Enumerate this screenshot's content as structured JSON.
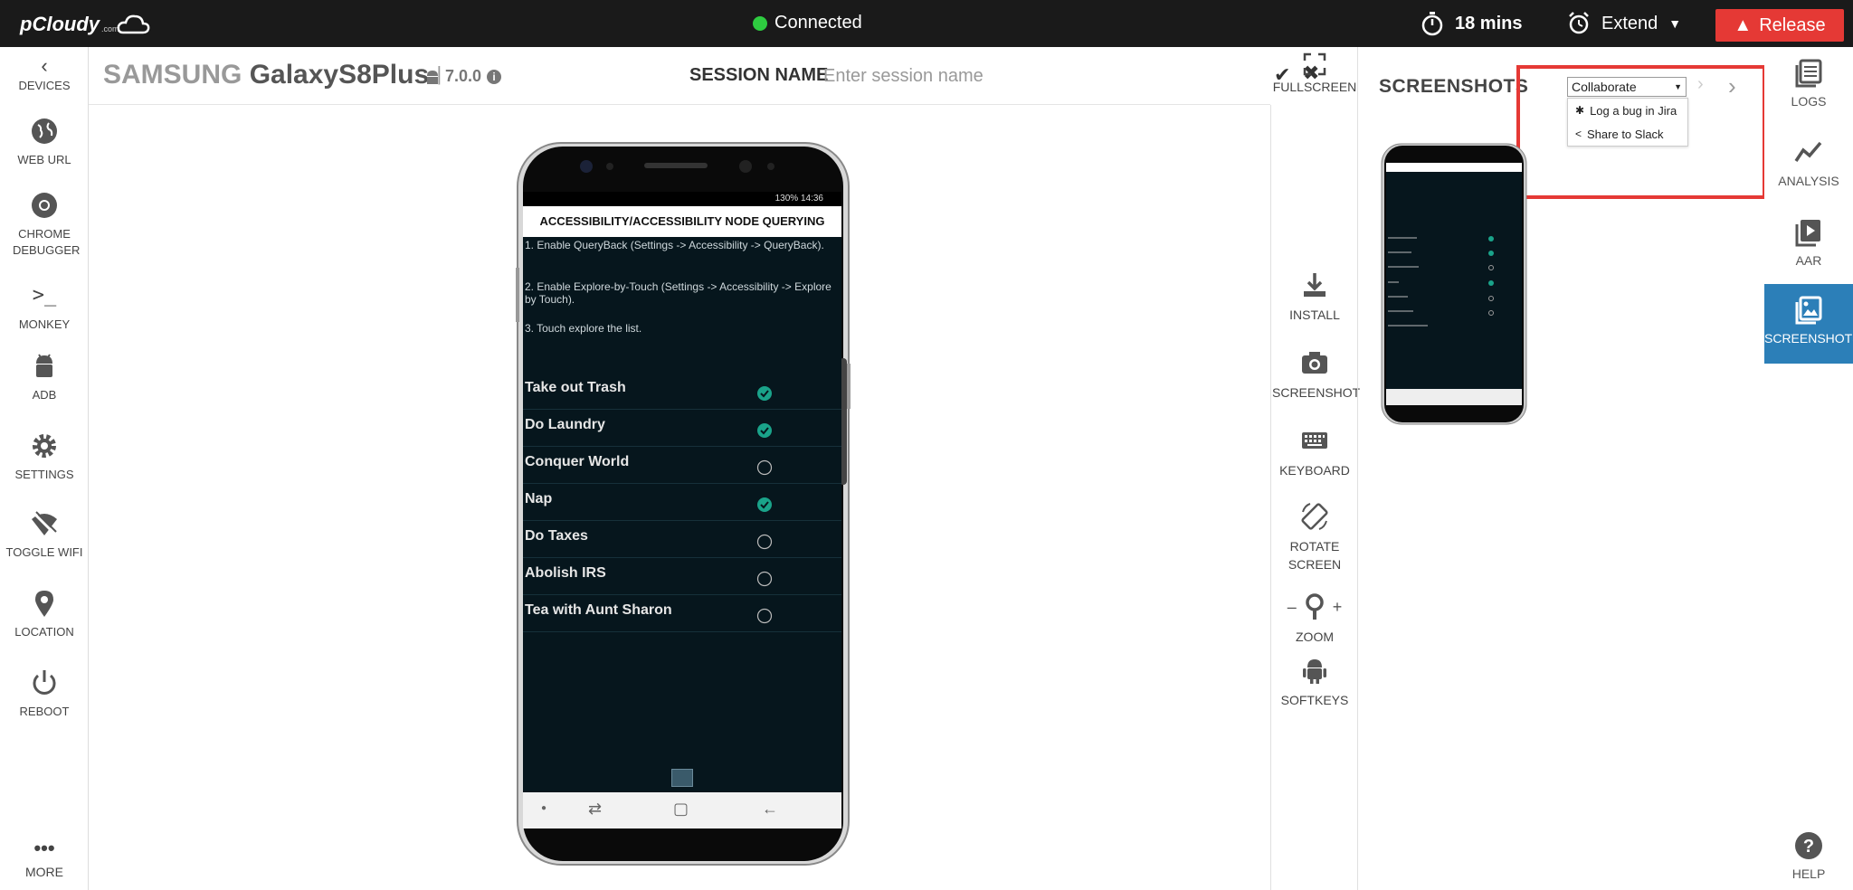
{
  "topbar": {
    "logo_text": "pCloudy",
    "logo_sub": ".com",
    "connection_status": "Connected",
    "timer": "18 mins",
    "extend_label": "Extend",
    "release_label": "Release"
  },
  "left_sidebar": {
    "items": [
      {
        "label": "DEVICES",
        "icon": "chevron-left-icon"
      },
      {
        "label": "WEB URL",
        "icon": "globe-icon"
      },
      {
        "label": "CHROME DEBUGGER",
        "icon": "chrome-icon"
      },
      {
        "label": "MONKEY",
        "icon": "terminal-icon"
      },
      {
        "label": "ADB",
        "icon": "android-icon"
      },
      {
        "label": "SETTINGS",
        "icon": "gear-icon"
      },
      {
        "label": "TOGGLE WIFI",
        "icon": "wifi-off-icon"
      },
      {
        "label": "LOCATION",
        "icon": "map-pin-icon"
      },
      {
        "label": "REBOOT",
        "icon": "power-icon"
      },
      {
        "label": "MORE",
        "icon": "ellipsis-icon"
      }
    ]
  },
  "device_header": {
    "brand": "SAMSUNG",
    "model": "GalaxyS8Plus",
    "separator": "|",
    "os_version": "7.0.0",
    "session_label": "SESSION NAME",
    "session_placeholder": "Enter session name"
  },
  "tools": {
    "fullscreen": "FULLSCREEN",
    "install": "INSTALL",
    "screenshot": "SCREENSHOT",
    "keyboard": "KEYBOARD",
    "rotate_line1": "ROTATE",
    "rotate_line2": "SCREEN",
    "zoom": "ZOOM",
    "zoom_minus": "–",
    "zoom_plus": "+",
    "softkeys": "SOFTKEYS"
  },
  "screenshots_panel": {
    "title": "SCREENSHOTS",
    "collaborate_label": "Collaborate",
    "menu": [
      {
        "label": "Log a bug in Jira",
        "icon": "bug-icon"
      },
      {
        "label": "Share to Slack",
        "icon": "share-icon"
      }
    ]
  },
  "right_sidebar": {
    "items": [
      {
        "label": "LOGS",
        "icon": "logs-icon",
        "active": false
      },
      {
        "label": "ANALYSIS",
        "icon": "analysis-icon",
        "active": false
      },
      {
        "label": "AAR",
        "icon": "video-icon",
        "active": false
      },
      {
        "label": "SCREENSHOTS",
        "icon": "image-icon",
        "active": true
      },
      {
        "label": "HELP",
        "icon": "help-icon",
        "active": false
      }
    ]
  },
  "phone_screen": {
    "status_bar": "130% 14:36",
    "app_title": "ACCESSIBILITY/ACCESSIBILITY NODE QUERYING",
    "instructions": [
      "1. Enable QueryBack (Settings -> Accessibility -> QueryBack).",
      "2. Enable Explore-by-Touch (Settings -> Accessibility -> Explore by Touch).",
      "3. Touch explore the list."
    ],
    "tasks": [
      {
        "name": "Take out Trash",
        "checked": true
      },
      {
        "name": "Do Laundry",
        "checked": true
      },
      {
        "name": "Conquer World",
        "checked": false
      },
      {
        "name": "Nap",
        "checked": true
      },
      {
        "name": "Do Taxes",
        "checked": false
      },
      {
        "name": "Abolish IRS",
        "checked": false
      },
      {
        "name": "Tea with Aunt Sharon",
        "checked": false
      }
    ]
  },
  "colors": {
    "topbar_bg": "#1a1a1a",
    "release_bg": "#e53935",
    "connected_dot": "#2ecc40",
    "active_tab": "#2c7fb8",
    "screen_bg": "#06161d",
    "check_teal": "#1aa38a",
    "highlight_border": "#e53935"
  }
}
